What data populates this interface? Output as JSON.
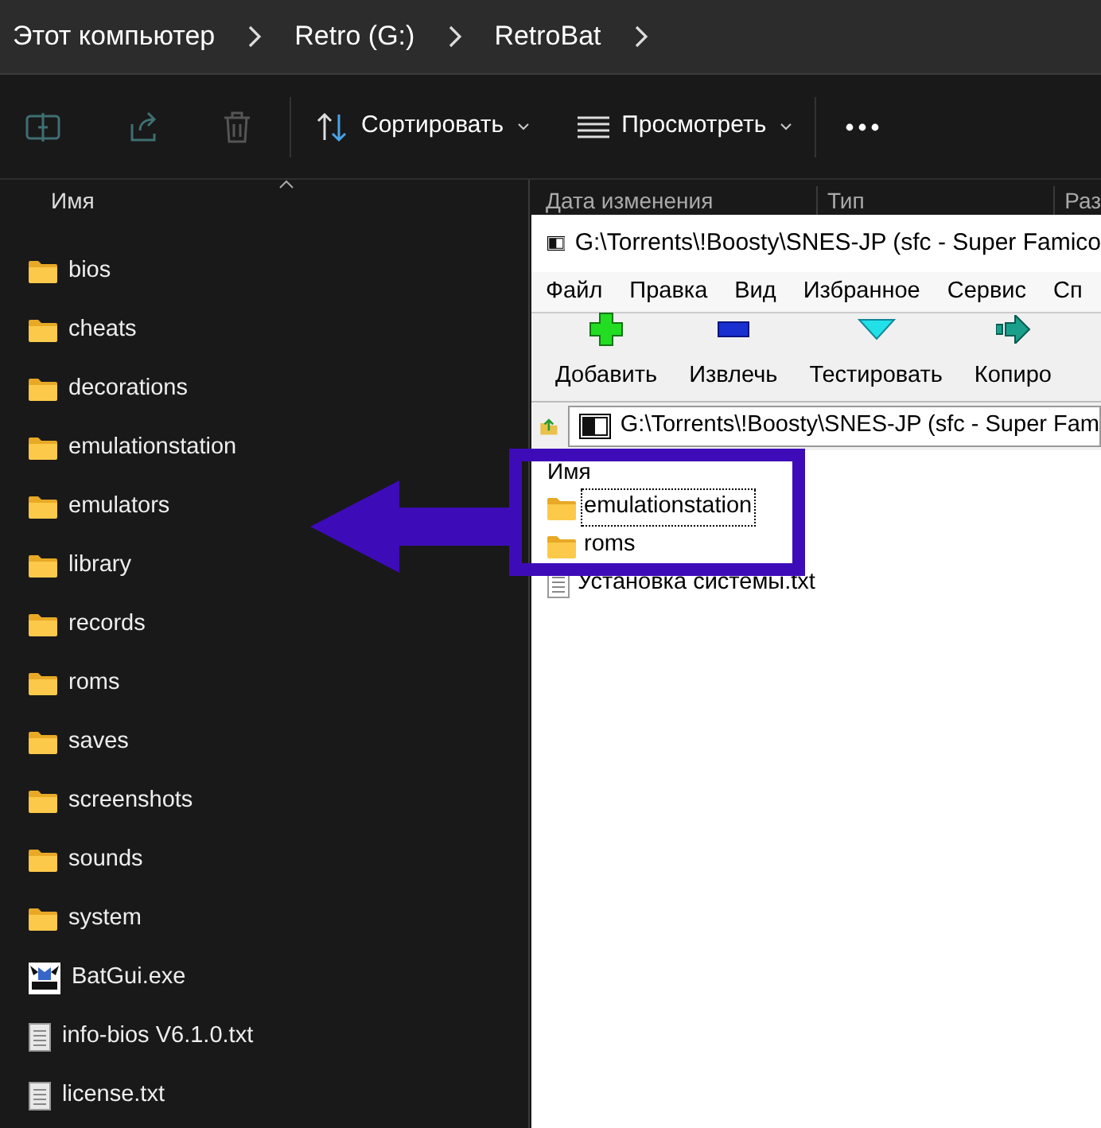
{
  "breadcrumb": [
    {
      "label": "Этот компьютер"
    },
    {
      "label": "Retro (G:)"
    },
    {
      "label": "RetroBat"
    }
  ],
  "toolbar": {
    "sort": "Сортировать",
    "view": "Просмотреть"
  },
  "columns": [
    "Имя",
    "Дата изменения",
    "Тип",
    "Раз"
  ],
  "files": [
    {
      "name": "bios",
      "kind": "folder"
    },
    {
      "name": "cheats",
      "kind": "folder"
    },
    {
      "name": "decorations",
      "kind": "folder"
    },
    {
      "name": "emulationstation",
      "kind": "folder"
    },
    {
      "name": "emulators",
      "kind": "folder"
    },
    {
      "name": "library",
      "kind": "folder"
    },
    {
      "name": "records",
      "kind": "folder"
    },
    {
      "name": "roms",
      "kind": "folder"
    },
    {
      "name": "saves",
      "kind": "folder"
    },
    {
      "name": "screenshots",
      "kind": "folder"
    },
    {
      "name": "sounds",
      "kind": "folder"
    },
    {
      "name": "system",
      "kind": "folder"
    },
    {
      "name": "BatGui.exe",
      "kind": "app"
    },
    {
      "name": "info-bios V6.1.0.txt",
      "kind": "text"
    },
    {
      "name": "license.txt",
      "kind": "text"
    }
  ],
  "archive_window": {
    "title": "G:\\Torrents\\!Boosty\\SNES-JP (sfc - Super Famico",
    "menu": [
      "Файл",
      "Правка",
      "Вид",
      "Избранное",
      "Сервис",
      "Сп"
    ],
    "tools": [
      {
        "label": "Добавить",
        "kind": "add"
      },
      {
        "label": "Извлечь",
        "kind": "extract"
      },
      {
        "label": "Тестировать",
        "kind": "test"
      },
      {
        "label": "Копиро",
        "kind": "copy"
      }
    ],
    "path": "G:\\Torrents\\!Boosty\\SNES-JP (sfc - Super Fam",
    "column": "Имя",
    "items": [
      {
        "name": "emulationstation",
        "kind": "folder",
        "selected": true
      },
      {
        "name": "roms",
        "kind": "folder",
        "selected": false
      },
      {
        "name": "Установка системы.txt",
        "kind": "text",
        "selected": false
      }
    ]
  }
}
